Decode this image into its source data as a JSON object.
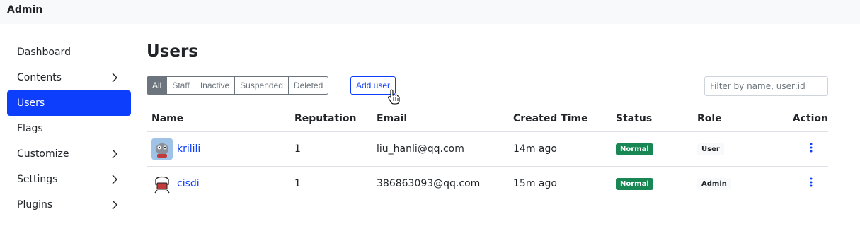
{
  "app": {
    "brand": "Admin"
  },
  "sidebar": {
    "items": [
      {
        "label": "Dashboard"
      },
      {
        "label": "Contents"
      },
      {
        "label": "Users"
      },
      {
        "label": "Flags"
      },
      {
        "label": "Customize"
      },
      {
        "label": "Settings"
      },
      {
        "label": "Plugins"
      }
    ]
  },
  "page": {
    "title": "Users"
  },
  "filters": [
    {
      "label": "All"
    },
    {
      "label": "Staff"
    },
    {
      "label": "Inactive"
    },
    {
      "label": "Suspended"
    },
    {
      "label": "Deleted"
    }
  ],
  "add_user_label": "Add user",
  "search": {
    "placeholder": "Filter by name, user:id"
  },
  "table": {
    "columns": [
      "Name",
      "Reputation",
      "Email",
      "Created Time",
      "Status",
      "Role",
      "Action"
    ],
    "rows": [
      {
        "name": "krilili",
        "reputation": "1",
        "email": "liu_hanli@qq.com",
        "created": "14m ago",
        "status": "Normal",
        "role": "User"
      },
      {
        "name": "cisdi",
        "reputation": "1",
        "email": "386863093@qq.com",
        "created": "15m ago",
        "status": "Normal",
        "role": "Admin"
      }
    ]
  },
  "colors": {
    "primary": "#0d3efc",
    "success": "#198754",
    "secondary": "#6c757d"
  },
  "icons": [
    "chevron-right-icon",
    "hand-cursor-icon",
    "kebab-menu-icon"
  ]
}
